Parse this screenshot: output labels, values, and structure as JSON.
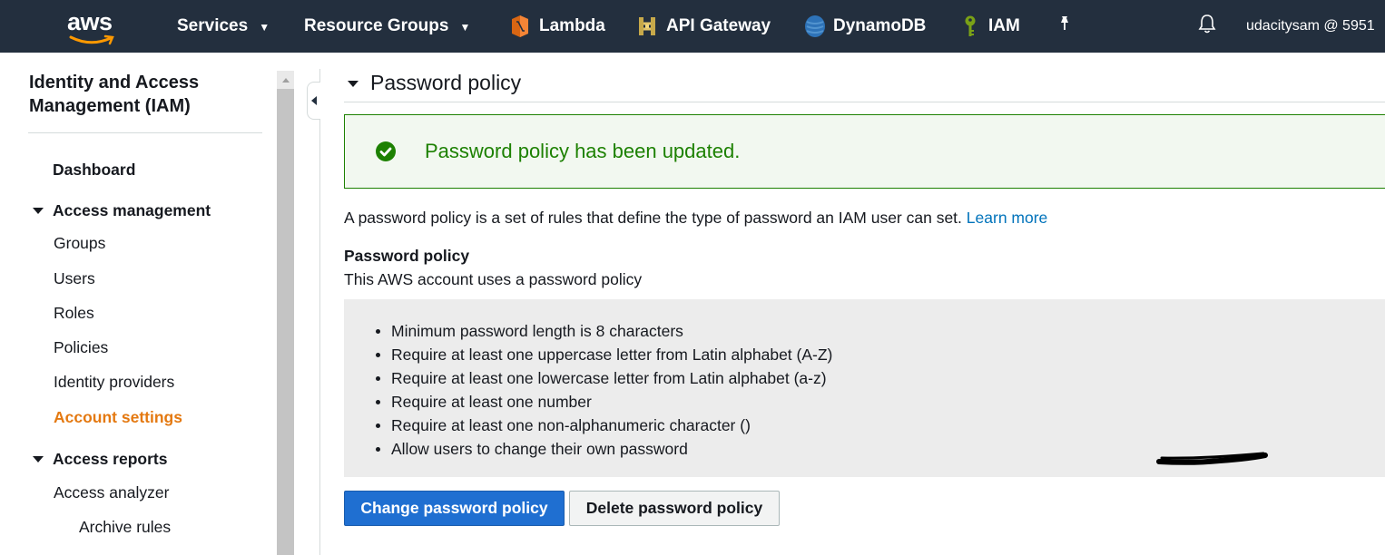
{
  "topnav": {
    "logo_text": "aws",
    "services": "Services",
    "resource_groups": "Resource Groups",
    "shortcuts": [
      {
        "label": "Lambda",
        "icon": "lambda-icon"
      },
      {
        "label": "API Gateway",
        "icon": "api-gateway-icon"
      },
      {
        "label": "DynamoDB",
        "icon": "dynamodb-icon"
      },
      {
        "label": "IAM",
        "icon": "iam-icon"
      }
    ],
    "pin_icon": "pin-icon",
    "bell_icon": "bell-icon",
    "account": "udacitysam @ 5951"
  },
  "sidebar": {
    "title": "Identity and Access Management (IAM)",
    "dashboard": "Dashboard",
    "access_management": {
      "label": "Access management",
      "items": [
        "Groups",
        "Users",
        "Roles",
        "Policies",
        "Identity providers",
        "Account settings"
      ]
    },
    "access_reports": {
      "label": "Access reports",
      "items": [
        "Access analyzer",
        "Archive rules"
      ]
    }
  },
  "main": {
    "section_title": "Password policy",
    "alert": "Password policy has been updated.",
    "description": "A password policy is a set of rules that define the type of password an IAM user can set.",
    "learn_more": "Learn more",
    "policy_title": "Password policy",
    "policy_subtitle": "This AWS account uses a password policy",
    "rules": [
      "Minimum password length is 8 characters",
      "Require at least one uppercase letter from Latin alphabet (A-Z)",
      "Require at least one lowercase letter from Latin alphabet (a-z)",
      "Require at least one number",
      "Require at least one non-alphanumeric character ()",
      "Allow users to change their own password"
    ],
    "change_button": "Change password policy",
    "delete_button": "Delete password policy"
  },
  "colors": {
    "nav_bg": "#232f3e",
    "success": "#1d8102",
    "link": "#0073bb",
    "active": "#e47911",
    "primary_button": "#1f6fd1"
  }
}
